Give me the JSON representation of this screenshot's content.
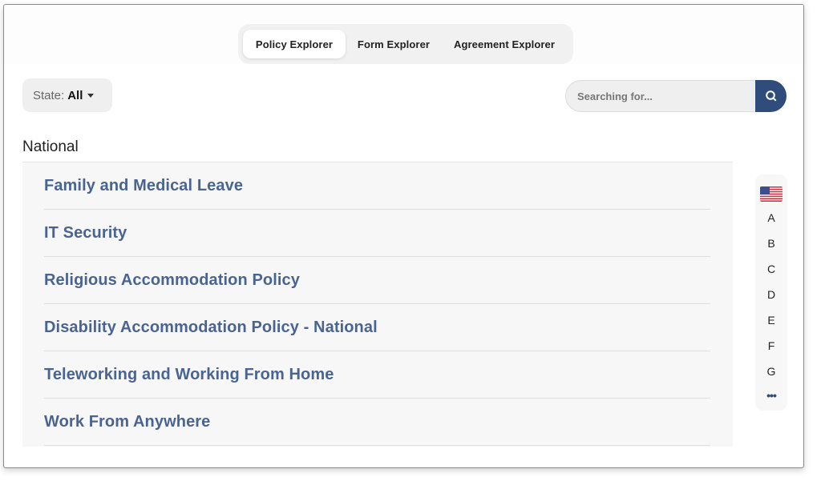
{
  "tabs": [
    {
      "label": "Policy Explorer",
      "active": true
    },
    {
      "label": "Form Explorer",
      "active": false
    },
    {
      "label": "Agreement Explorer",
      "active": false
    }
  ],
  "filters": {
    "state_label": "State:",
    "state_value": "All"
  },
  "search": {
    "placeholder": "Searching for...",
    "value": ""
  },
  "section": {
    "title": "National",
    "items": [
      "Family and Medical Leave",
      "IT Security",
      "Religious Accommodation Policy",
      "Disability Accommodation Policy - National",
      "Teleworking and Working From Home",
      "Work From Anywhere"
    ]
  },
  "alpha_index": {
    "flag_icon": "us-flag-icon",
    "letters": [
      "A",
      "B",
      "C",
      "D",
      "E",
      "F",
      "G"
    ],
    "more": "•••"
  },
  "colors": {
    "accent": "#2f4c7a",
    "link": "#4a6491"
  }
}
